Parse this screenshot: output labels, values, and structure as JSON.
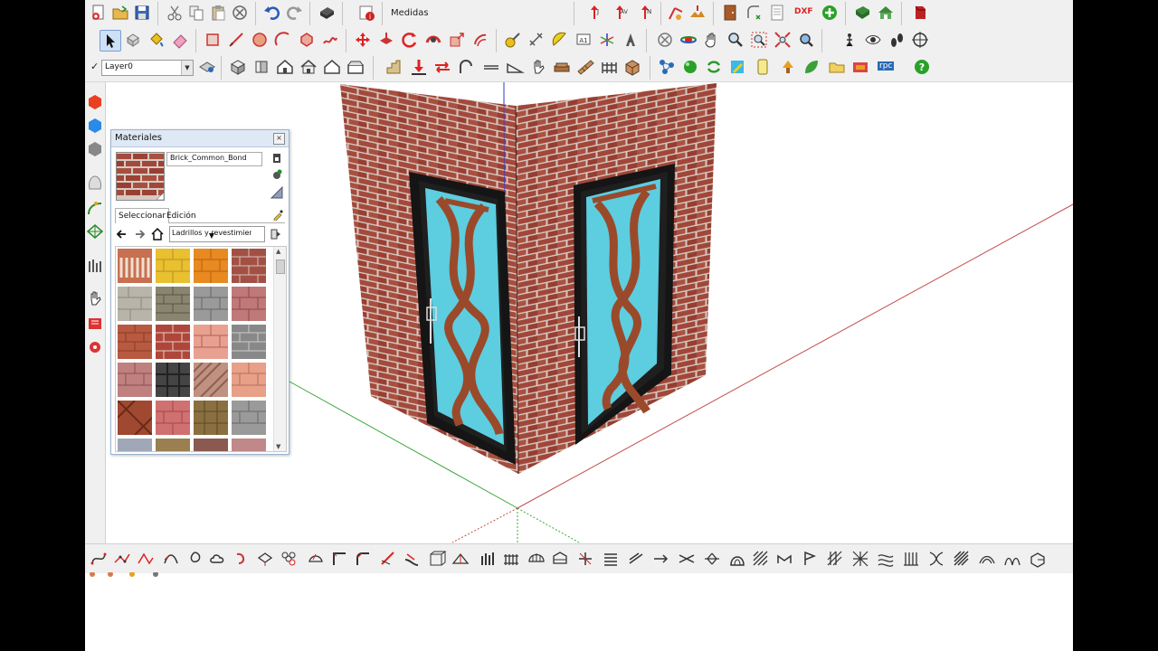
{
  "toolbar": {
    "measurements_label": "Medidas",
    "dxf_label": "DXF",
    "rpc_label": "rpc",
    "layer": {
      "current": "Layer0",
      "check": "✓"
    }
  },
  "materials_panel": {
    "title": "Materiales",
    "close": "×",
    "material_name": "Brick_Common_Bond",
    "tabs": [
      {
        "label": "Seleccionar"
      },
      {
        "label": "Edición"
      }
    ],
    "category": "Ladrillos y revestimientos"
  },
  "colors": {
    "brick": "#a34a3c",
    "mortar": "#d9c8c2",
    "door_frame": "#151515",
    "door_glass": "#5dcde0",
    "door_wood": "#9a4a2a",
    "axis_red": "#c44c4c",
    "axis_green": "#3aa83a",
    "axis_blue": "#3a3acc",
    "toolbar_bg": "#f0f0f0",
    "panel_title_bg": "#dfe9f5"
  }
}
